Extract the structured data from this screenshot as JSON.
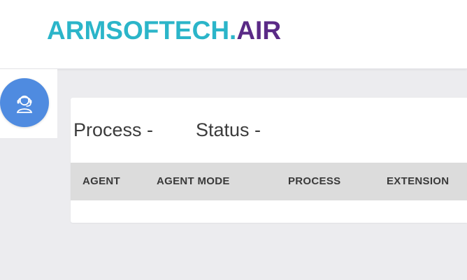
{
  "header": {
    "logo_brand": "ARMSOFTECH.",
    "logo_tld": "AIR",
    "colors": {
      "brand": "#2bb5c9",
      "tld": "#5a2a86",
      "background": "#ffffff"
    }
  },
  "sidebar": {
    "agent_button_icon": "headset-agent-icon",
    "agent_button_color": "#4f8be0"
  },
  "main": {
    "process_label": "Process -",
    "status_label": "Status -",
    "table": {
      "columns": [
        "AGENT",
        "AGENT MODE",
        "PROCESS",
        "EXTENSION"
      ],
      "rows": []
    }
  }
}
